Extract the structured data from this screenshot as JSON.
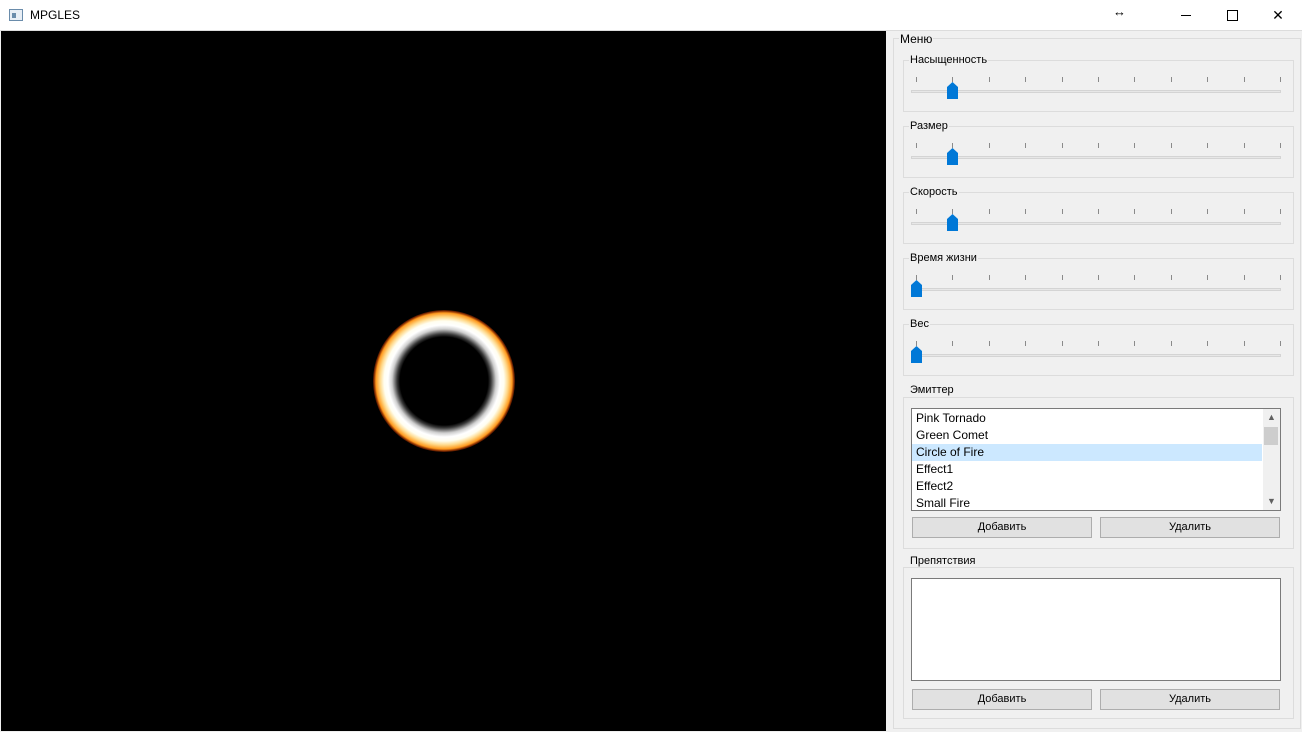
{
  "window": {
    "title": "MPGLES",
    "resize_cursor": "↔",
    "controls": {
      "minimize": "minimize-icon",
      "maximize": "maximize-icon",
      "close": "✕"
    }
  },
  "menu": {
    "title": "Меню",
    "sliders": [
      {
        "label": "Насыщенность",
        "level": 0.1
      },
      {
        "label": "Размер",
        "level": 0.1
      },
      {
        "label": "Скорость",
        "level": 0.1
      },
      {
        "label": "Время жизни",
        "level": 0.0
      },
      {
        "label": "Вес",
        "level": 0.0
      }
    ],
    "emitter": {
      "title": "Эмиттер",
      "items": [
        "Pink Tornado",
        "Green Comet",
        "Circle of Fire",
        "Effect1",
        "Effect2",
        "Small Fire"
      ],
      "selected": "Circle of Fire",
      "add_label": "Добавить",
      "remove_label": "Удалить"
    },
    "obstacles": {
      "title": "Препятствия",
      "items": [],
      "add_label": "Добавить",
      "remove_label": "Удалить"
    }
  },
  "colors": {
    "accent": "#0078d7",
    "selection": "#cce8ff",
    "viewport": "#000000"
  }
}
